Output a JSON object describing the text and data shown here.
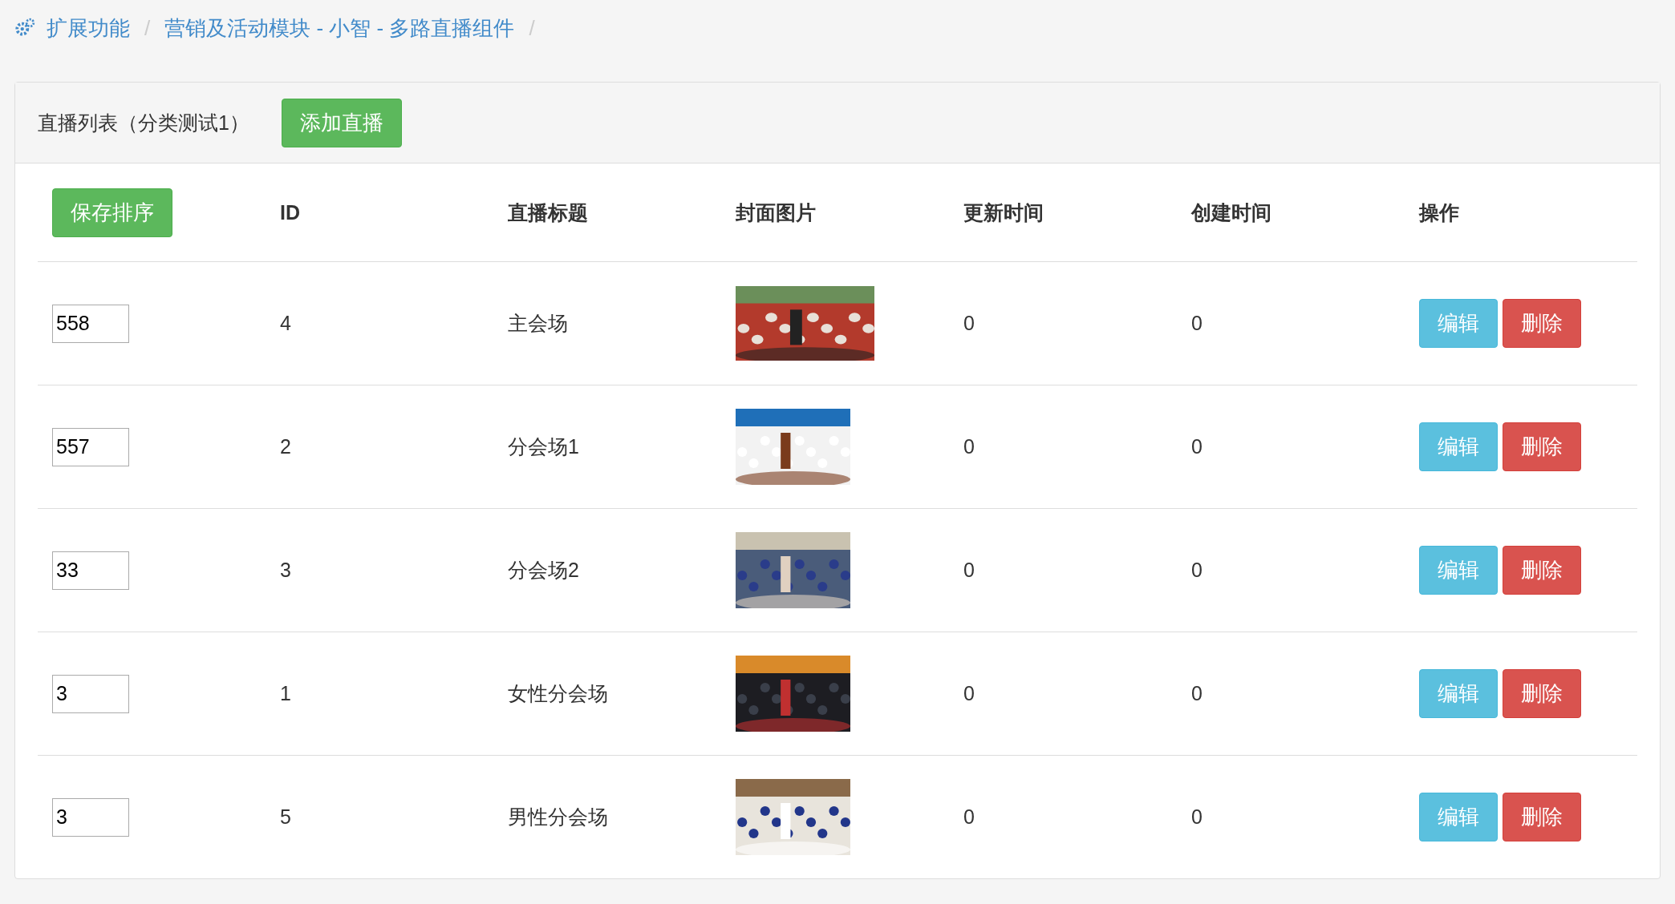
{
  "breadcrumb": {
    "separator": "/",
    "items": [
      "扩展功能",
      "营销及活动模块 - 小智 - 多路直播组件"
    ]
  },
  "panel": {
    "title": "直播列表（分类测试1）",
    "add_button": "添加直播"
  },
  "table": {
    "save_sort_button": "保存排序",
    "columns": [
      "ID",
      "直播标题",
      "封面图片",
      "更新时间",
      "创建时间",
      "操作"
    ],
    "rows": [
      {
        "sort": "558",
        "id": "4",
        "title": "主会场",
        "updated": "0",
        "created": "0",
        "actions": [
          {
            "label": "编辑",
            "kind": "edit"
          },
          {
            "label": "删除",
            "kind": "delete"
          }
        ]
      },
      {
        "sort": "557",
        "id": "2",
        "title": "分会场1",
        "updated": "0",
        "created": "0",
        "actions": [
          {
            "label": "编辑",
            "kind": "edit"
          },
          {
            "label": "删除",
            "kind": "delete"
          }
        ]
      },
      {
        "sort": "33",
        "id": "3",
        "title": "分会场2",
        "updated": "0",
        "created": "0",
        "actions": [
          {
            "label": "编辑",
            "kind": "edit"
          },
          {
            "label": "删除",
            "kind": "delete"
          }
        ]
      },
      {
        "sort": "3",
        "id": "1",
        "title": "女性分会场",
        "updated": "0",
        "created": "0",
        "actions": [
          {
            "label": "编辑",
            "kind": "edit"
          },
          {
            "label": "删除",
            "kind": "delete"
          }
        ]
      },
      {
        "sort": "3",
        "id": "5",
        "title": "男性分会场",
        "updated": "0",
        "created": "0",
        "actions": [
          {
            "label": "编辑",
            "kind": "edit"
          },
          {
            "label": "删除",
            "kind": "delete"
          }
        ]
      }
    ]
  }
}
